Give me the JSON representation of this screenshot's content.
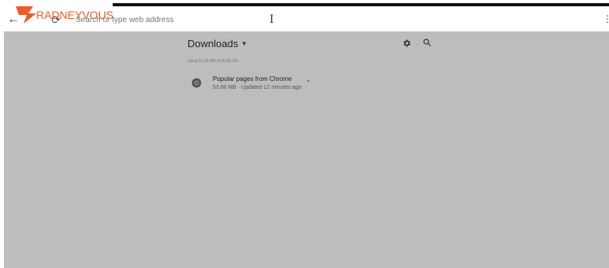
{
  "browser": {
    "logo_text": "RADNEYVOUS",
    "omnibox_placeholder": "Search or type web address",
    "menu_icon": "more-vert-icon",
    "back_icon": "arrow-left-icon",
    "reload_icon": "reload-icon",
    "cursor_icon": "text-cursor-icon"
  },
  "downloads": {
    "title": "Downloads",
    "storage_text": "Using 51.18 MB of 26.80 GB",
    "settings_icon": "gear-icon",
    "search_icon": "search-icon",
    "items": [
      {
        "title": "Popular pages from Chrome",
        "subtitle": "53.66 MB · Updated 12 minutes ago",
        "icon": "chrome-icon"
      }
    ]
  },
  "colors": {
    "content_bg": "#bdbdbd",
    "logo_orange": "#f05a28"
  }
}
